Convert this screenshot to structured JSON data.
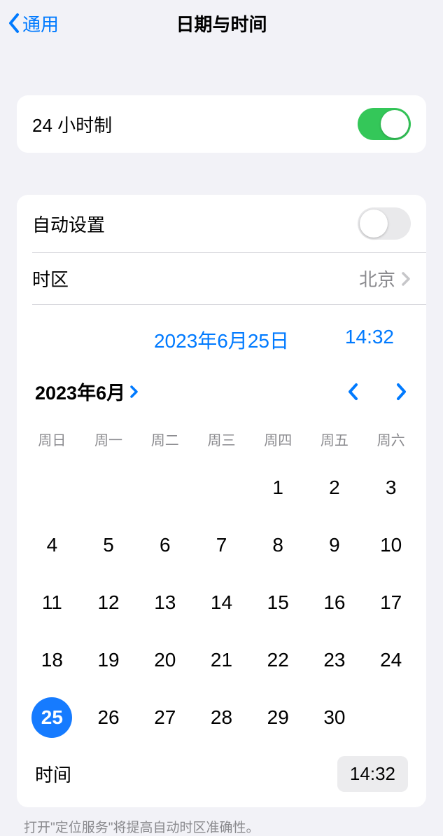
{
  "nav": {
    "back": "通用",
    "title": "日期与时间"
  },
  "rows": {
    "time_format_label": "24 小时制",
    "time_format_on": true,
    "auto_set_label": "自动设置",
    "auto_set_on": false,
    "timezone_label": "时区",
    "timezone_value": "北京"
  },
  "picker": {
    "date_display": "2023年6月25日",
    "time_display": "14:32",
    "month_label": "2023年6月",
    "weekdays": [
      "周日",
      "周一",
      "周二",
      "周三",
      "周四",
      "周五",
      "周六"
    ],
    "leading_blanks": 4,
    "days": [
      1,
      2,
      3,
      4,
      5,
      6,
      7,
      8,
      9,
      10,
      11,
      12,
      13,
      14,
      15,
      16,
      17,
      18,
      19,
      20,
      21,
      22,
      23,
      24,
      25,
      26,
      27,
      28,
      29,
      30
    ],
    "selected_day": 25,
    "time_row_label": "时间",
    "time_row_value": "14:32"
  },
  "footnote": "打开\"定位服务\"将提高自动时区准确性。"
}
